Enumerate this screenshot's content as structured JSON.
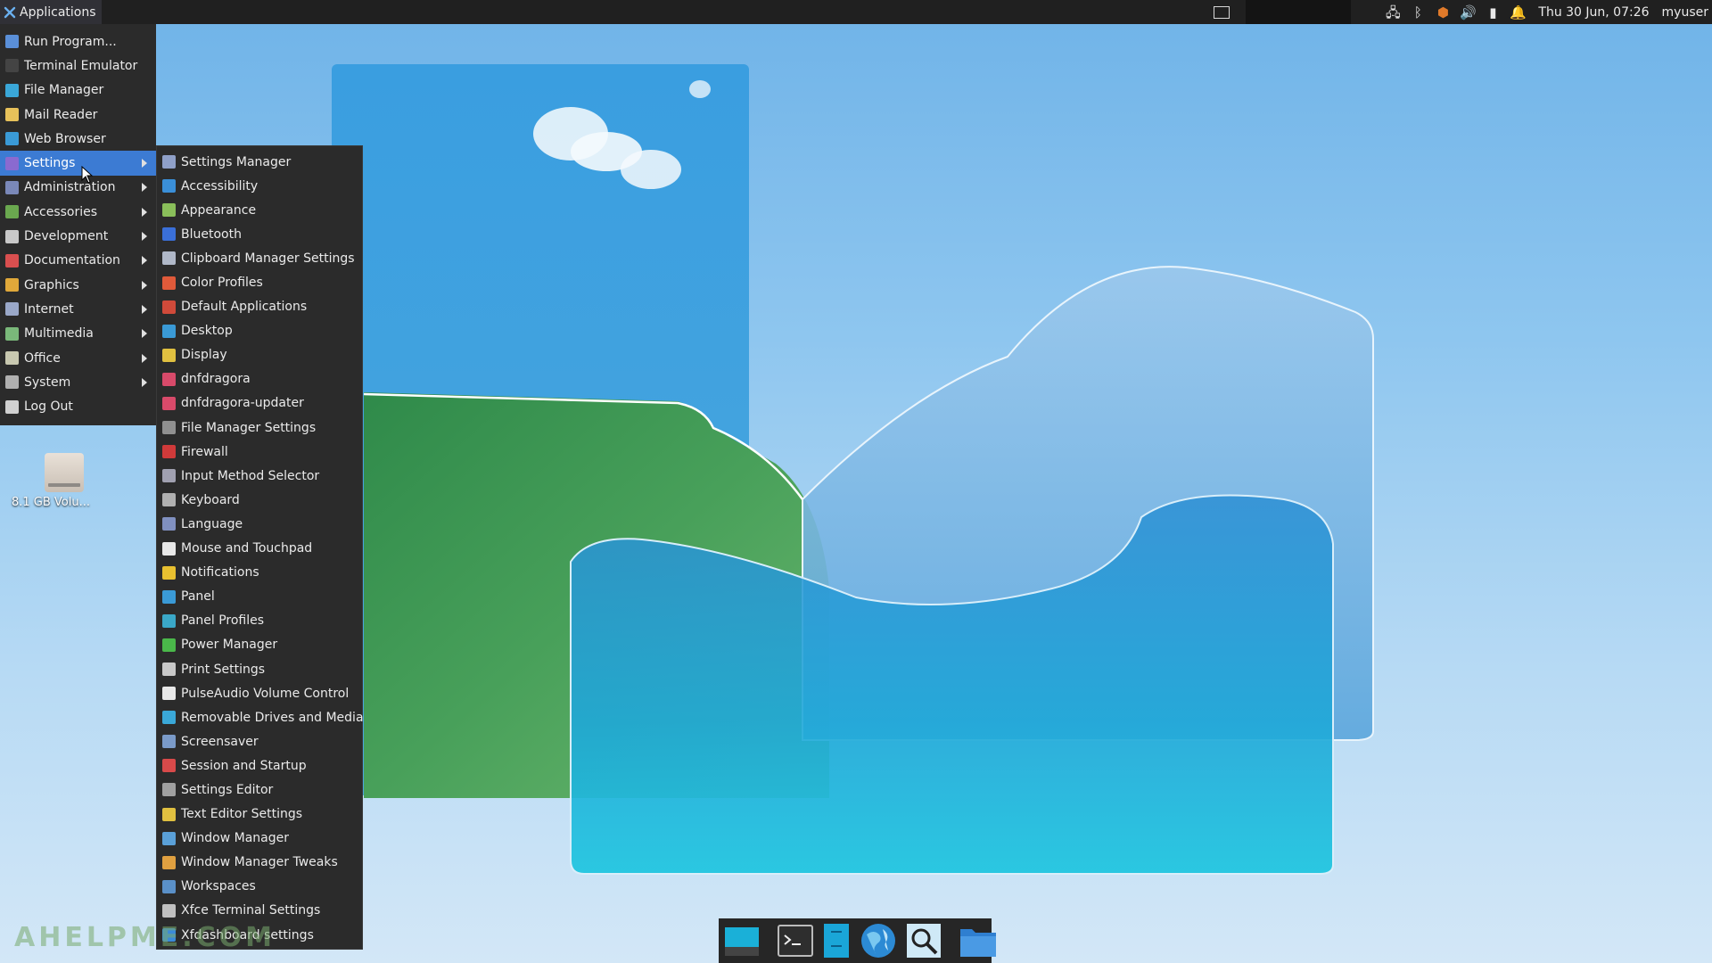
{
  "top_panel": {
    "applications_label": "Applications",
    "clock": "Thu 30 Jun, 07:26",
    "user": "myuser",
    "tray_icons": [
      "network-icon",
      "bluetooth-icon",
      "shield-update-icon",
      "volume-icon",
      "battery-icon",
      "notification-bell-icon"
    ]
  },
  "main_menu": {
    "items": [
      {
        "label": "Run Program...",
        "icon": "run-icon",
        "color": "#5a8fd8"
      },
      {
        "label": "Terminal Emulator",
        "icon": "terminal-icon",
        "color": "#444444"
      },
      {
        "label": "File Manager",
        "icon": "file-manager-icon",
        "color": "#3aa7d8"
      },
      {
        "label": "Mail Reader",
        "icon": "mail-icon",
        "color": "#e7c15a"
      },
      {
        "label": "Web Browser",
        "icon": "globe-icon",
        "color": "#3a9ad6"
      },
      {
        "label": "Settings",
        "icon": "settings-icon",
        "color": "#8a6ad0"
      },
      {
        "label": "Administration",
        "icon": "tools-icon",
        "color": "#7a88b8"
      },
      {
        "label": "Accessories",
        "icon": "accessories-icon",
        "color": "#6aa84f"
      },
      {
        "label": "Development",
        "icon": "development-icon",
        "color": "#c8c8c8"
      },
      {
        "label": "Documentation",
        "icon": "help-icon",
        "color": "#d94f4f"
      },
      {
        "label": "Graphics",
        "icon": "graphics-icon",
        "color": "#e0a83a"
      },
      {
        "label": "Internet",
        "icon": "internet-icon",
        "color": "#9aa8c8"
      },
      {
        "label": "Multimedia",
        "icon": "multimedia-icon",
        "color": "#7ab87a"
      },
      {
        "label": "Office",
        "icon": "office-icon",
        "color": "#c8c8b0"
      },
      {
        "label": "System",
        "icon": "system-icon",
        "color": "#b0b0b0"
      },
      {
        "label": "Log Out",
        "icon": "logout-icon",
        "color": "#d0d0d0"
      }
    ]
  },
  "settings_menu": {
    "items": [
      {
        "label": "Settings Manager",
        "icon": "settings-manager-icon",
        "color": "#8fa0c8"
      },
      {
        "label": "Accessibility",
        "icon": "accessibility-icon",
        "color": "#3a8fd8"
      },
      {
        "label": "Appearance",
        "icon": "appearance-icon",
        "color": "#8abf5a"
      },
      {
        "label": "Bluetooth",
        "icon": "bluetooth-icon",
        "color": "#3a6fd8"
      },
      {
        "label": "Clipboard Manager Settings",
        "icon": "clipboard-icon",
        "color": "#b0b8c8"
      },
      {
        "label": "Color Profiles",
        "icon": "color-profiles-icon",
        "color": "#e05a3a"
      },
      {
        "label": "Default Applications",
        "icon": "default-apps-icon",
        "color": "#d04a3a"
      },
      {
        "label": "Desktop",
        "icon": "desktop-icon",
        "color": "#3a9ad6"
      },
      {
        "label": "Display",
        "icon": "display-icon",
        "color": "#e0c040"
      },
      {
        "label": "dnfdragora",
        "icon": "dnfdragora-icon",
        "color": "#d84a6a"
      },
      {
        "label": "dnfdragora-updater",
        "icon": "dnfdragora-updater-icon",
        "color": "#d84a6a"
      },
      {
        "label": "File Manager Settings",
        "icon": "file-manager-settings-icon",
        "color": "#909090"
      },
      {
        "label": "Firewall",
        "icon": "firewall-icon",
        "color": "#d03a3a"
      },
      {
        "label": "Input Method Selector",
        "icon": "input-method-icon",
        "color": "#a0a0b0"
      },
      {
        "label": "Keyboard",
        "icon": "keyboard-icon",
        "color": "#b0b0b0"
      },
      {
        "label": "Language",
        "icon": "language-icon",
        "color": "#8090c0"
      },
      {
        "label": "Mouse and Touchpad",
        "icon": "mouse-icon",
        "color": "#e8e8e8"
      },
      {
        "label": "Notifications",
        "icon": "notifications-icon",
        "color": "#e8c030"
      },
      {
        "label": "Panel",
        "icon": "panel-icon",
        "color": "#3a9ad6"
      },
      {
        "label": "Panel Profiles",
        "icon": "panel-profiles-icon",
        "color": "#3aa8c8"
      },
      {
        "label": "Power Manager",
        "icon": "power-manager-icon",
        "color": "#4ab84a"
      },
      {
        "label": "Print Settings",
        "icon": "print-icon",
        "color": "#c8c8c8"
      },
      {
        "label": "PulseAudio Volume Control",
        "icon": "pulseaudio-icon",
        "color": "#e8e8e8"
      },
      {
        "label": "Removable Drives and Media",
        "icon": "removable-drives-icon",
        "color": "#3aa8d8"
      },
      {
        "label": "Screensaver",
        "icon": "screensaver-icon",
        "color": "#7a9ac8"
      },
      {
        "label": "Session and Startup",
        "icon": "session-icon",
        "color": "#d84a4a"
      },
      {
        "label": "Settings Editor",
        "icon": "settings-editor-icon",
        "color": "#a0a0a0"
      },
      {
        "label": "Text Editor Settings",
        "icon": "text-editor-icon",
        "color": "#e0c040"
      },
      {
        "label": "Window Manager",
        "icon": "window-manager-icon",
        "color": "#5aa0d8"
      },
      {
        "label": "Window Manager Tweaks",
        "icon": "window-manager-tweaks-icon",
        "color": "#e0a040"
      },
      {
        "label": "Workspaces",
        "icon": "workspaces-icon",
        "color": "#5a90c8"
      },
      {
        "label": "Xfce Terminal Settings",
        "icon": "xfce-terminal-icon",
        "color": "#c0c0c0"
      },
      {
        "label": "Xfdashboard settings",
        "icon": "xfdashboard-icon",
        "color": "#3a8ad8"
      }
    ]
  },
  "desktop": {
    "drive_label": "8.1 GB Volu...",
    "watermark": "AHELPME.COM"
  },
  "dock": {
    "items": [
      "show-desktop-icon",
      "terminal-icon",
      "file-manager-icon",
      "web-browser-icon",
      "app-finder-icon",
      "folder-icon"
    ]
  },
  "colors": {
    "panel": "#202020",
    "menu": "#2b2b2b",
    "highlight": "#3c7bd3"
  }
}
